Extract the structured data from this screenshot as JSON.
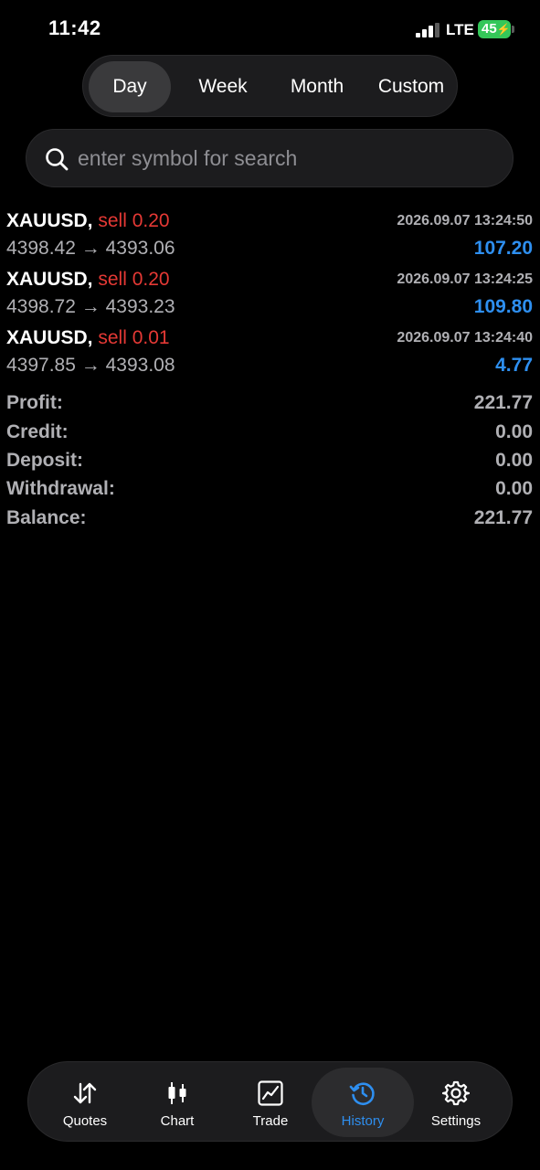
{
  "status_bar": {
    "time": "11:42",
    "network": "LTE",
    "battery": "45"
  },
  "period_tabs": [
    "Day",
    "Week",
    "Month",
    "Custom"
  ],
  "period_selected": "Day",
  "search": {
    "placeholder": "enter symbol for search"
  },
  "trades": [
    {
      "symbol": "XAUUSD,",
      "side": "sell 0.20",
      "open": "4398.42",
      "arrow": "→",
      "close": "4393.06",
      "time": "2026.09.07 13:24:50",
      "profit": "107.20"
    },
    {
      "symbol": "XAUUSD,",
      "side": "sell 0.20",
      "open": "4398.72",
      "arrow": "→",
      "close": "4393.23",
      "time": "2026.09.07 13:24:25",
      "profit": "109.80"
    },
    {
      "symbol": "XAUUSD,",
      "side": "sell 0.01",
      "open": "4397.85",
      "arrow": "→",
      "close": "4393.08",
      "time": "2026.09.07 13:24:40",
      "profit": "4.77"
    }
  ],
  "summary": {
    "profit": {
      "label": "Profit:",
      "value": "221.77"
    },
    "credit": {
      "label": "Credit:",
      "value": "0.00"
    },
    "deposit": {
      "label": "Deposit:",
      "value": "0.00"
    },
    "withdrawal": {
      "label": "Withdrawal:",
      "value": "0.00"
    },
    "balance": {
      "label": "Balance:",
      "value": "221.77"
    }
  },
  "tabbar": [
    {
      "label": "Quotes",
      "icon": "quotes-arrows-icon"
    },
    {
      "label": "Chart",
      "icon": "candlestick-chart-icon"
    },
    {
      "label": "Trade",
      "icon": "trade-line-chart-icon"
    },
    {
      "label": "History",
      "icon": "history-clock-icon"
    },
    {
      "label": "Settings",
      "icon": "gear-icon"
    }
  ],
  "tabbar_selected": "History",
  "colors": {
    "accent": "#2e8ff0",
    "sell": "#e53935",
    "battery": "#34c759",
    "background": "#000000"
  }
}
